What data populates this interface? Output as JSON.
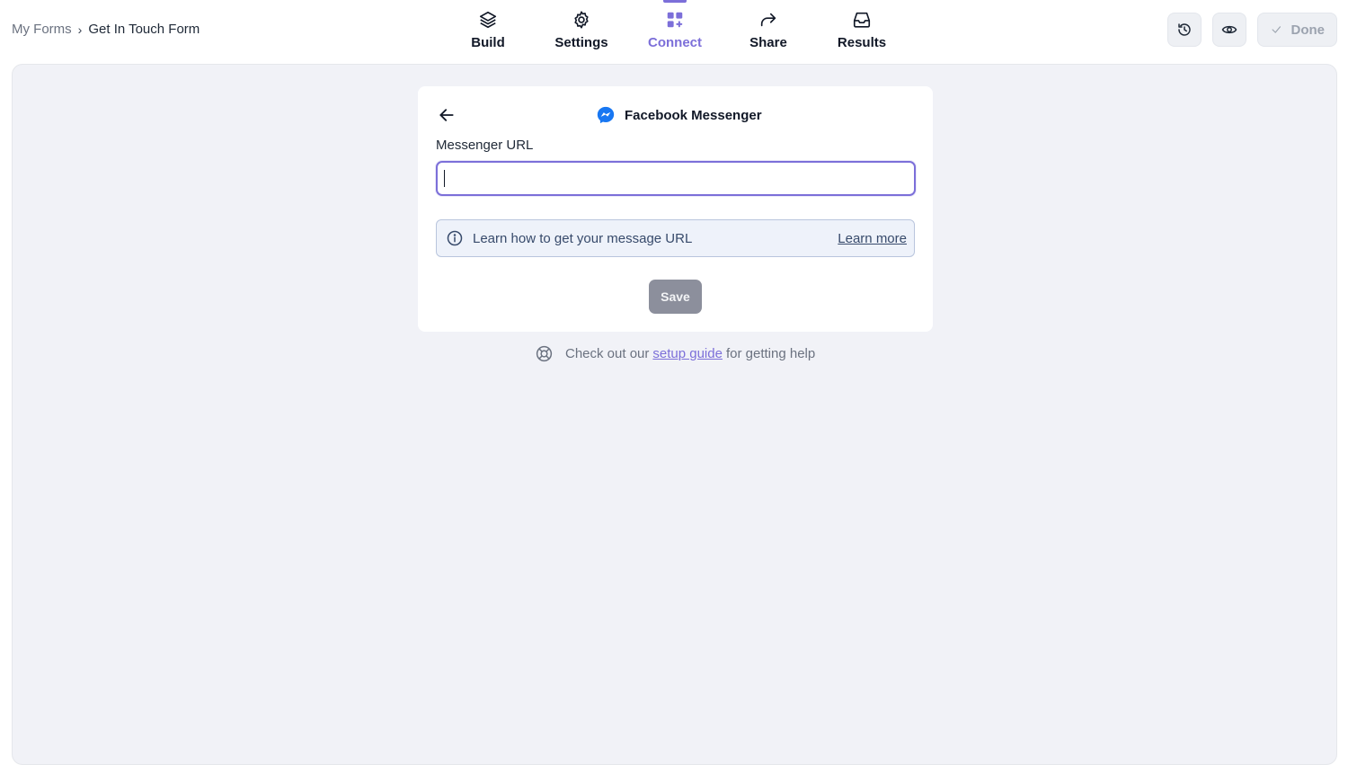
{
  "breadcrumb": {
    "root": "My Forms",
    "separator": "›",
    "current": "Get In Touch Form"
  },
  "tabs": [
    {
      "label": "Build",
      "icon": "layers-icon",
      "active": false
    },
    {
      "label": "Settings",
      "icon": "gear-icon",
      "active": false
    },
    {
      "label": "Connect",
      "icon": "apps-add-icon",
      "active": true
    },
    {
      "label": "Share",
      "icon": "share-arrow-icon",
      "active": false
    },
    {
      "label": "Results",
      "icon": "inbox-icon",
      "active": false
    }
  ],
  "actions": {
    "history_icon": "history-icon",
    "preview_icon": "eye-icon",
    "done_label": "Done"
  },
  "card": {
    "title": "Facebook Messenger",
    "field_label": "Messenger URL",
    "input_value": "",
    "info_text": "Learn how to get your message URL",
    "learn_more": "Learn more",
    "save_label": "Save"
  },
  "help": {
    "prefix": "Check out our",
    "link": "setup guide",
    "suffix": "for getting help"
  },
  "colors": {
    "accent": "#7c6fd9",
    "canvas_bg": "#f1f2f7",
    "info_bg": "#eef2fa",
    "messenger_blue": "#1877f2"
  }
}
